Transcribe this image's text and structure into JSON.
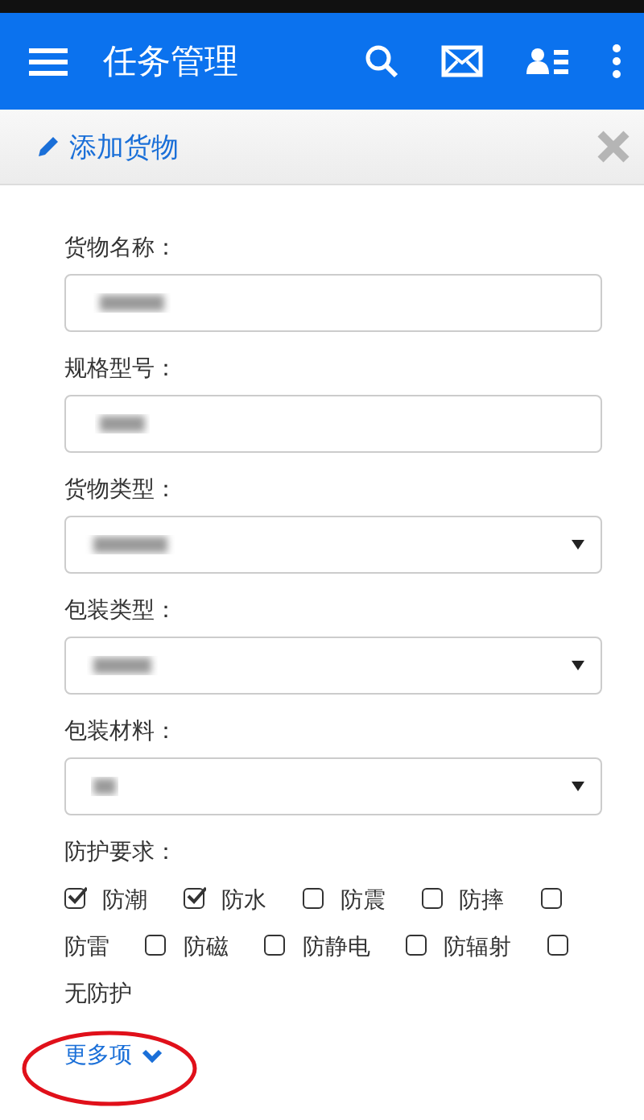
{
  "app_bar": {
    "title": "任务管理"
  },
  "panel": {
    "title": "添加货物"
  },
  "fields": [
    {
      "label": "货物名称：",
      "kind": "text"
    },
    {
      "label": "规格型号：",
      "kind": "text"
    },
    {
      "label": "货物类型：",
      "kind": "select"
    },
    {
      "label": "包装类型：",
      "kind": "select"
    },
    {
      "label": "包装材料：",
      "kind": "select"
    }
  ],
  "protection": {
    "label": "防护要求：",
    "options": [
      {
        "label": "防潮",
        "checked": true
      },
      {
        "label": "防水",
        "checked": true
      },
      {
        "label": "防震",
        "checked": false
      },
      {
        "label": "防摔",
        "checked": false
      },
      {
        "label": "防雷",
        "checked": false
      },
      {
        "label": "防磁",
        "checked": false
      },
      {
        "label": "防静电",
        "checked": false
      },
      {
        "label": "防辐射",
        "checked": false
      },
      {
        "label": "无防护",
        "checked": false
      }
    ]
  },
  "more_link": {
    "label": "更多项"
  }
}
